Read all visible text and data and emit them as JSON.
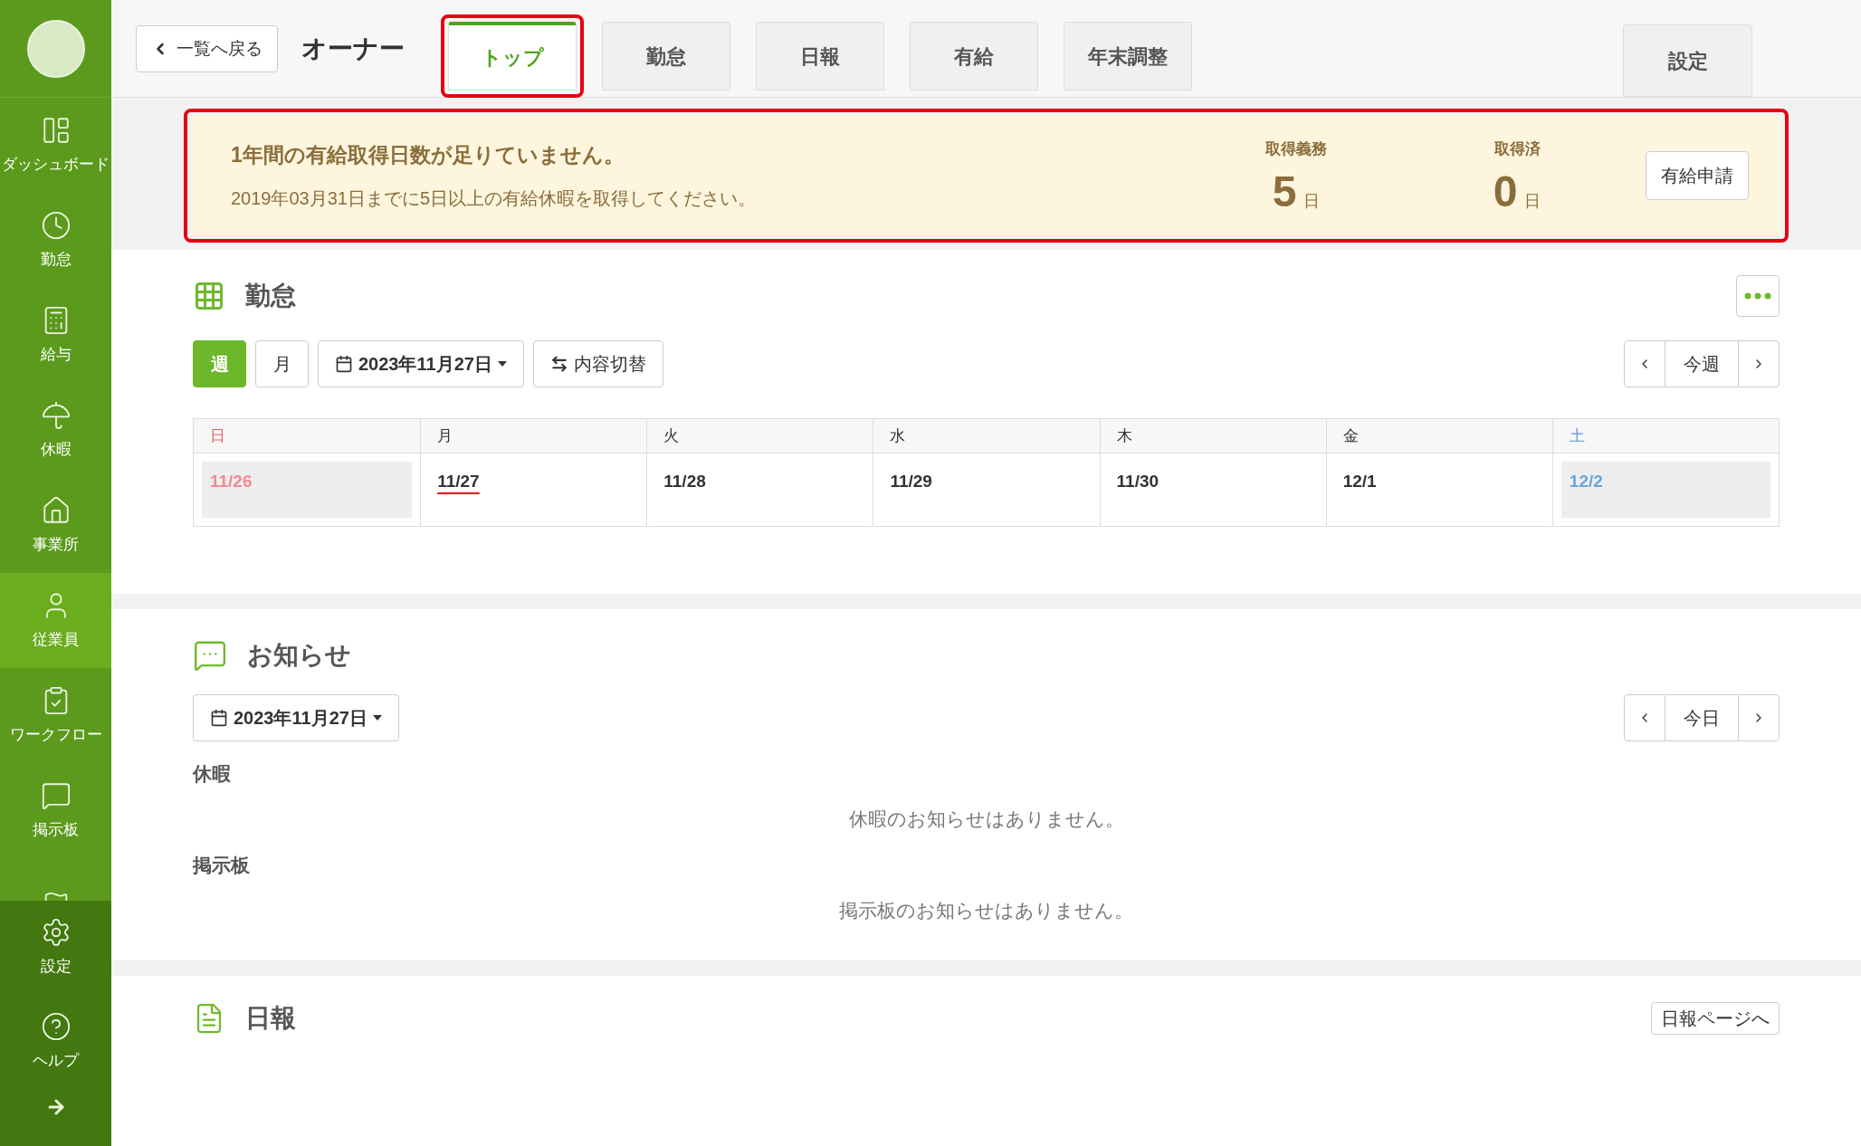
{
  "sidebar": {
    "items": [
      {
        "kind": "dashboard",
        "label": "ダッシュボード",
        "selected": false
      },
      {
        "kind": "clock",
        "label": "勤怠",
        "selected": false
      },
      {
        "kind": "calculator",
        "label": "給与",
        "selected": false
      },
      {
        "kind": "umbrella",
        "label": "休暇",
        "selected": false
      },
      {
        "kind": "house",
        "label": "事業所",
        "selected": false
      },
      {
        "kind": "person",
        "label": "従業員",
        "selected": true
      },
      {
        "kind": "clipboard",
        "label": "ワークフロー",
        "selected": false
      },
      {
        "kind": "chat",
        "label": "掲示板",
        "selected": false
      },
      {
        "kind": "flag"
      }
    ],
    "bottom_items": [
      {
        "kind": "settings",
        "label": "設定"
      },
      {
        "kind": "help",
        "label": "ヘルプ"
      }
    ]
  },
  "header": {
    "back_button": "一覧へ戻る",
    "title": "オーナー",
    "tabs": [
      {
        "label": "トップ",
        "selected": true,
        "highlighted": true
      },
      {
        "label": "勤怠",
        "selected": false,
        "highlighted": false
      },
      {
        "label": "日報",
        "selected": false,
        "highlighted": false
      },
      {
        "label": "有給",
        "selected": false,
        "highlighted": false
      },
      {
        "label": "年末調整",
        "selected": false,
        "highlighted": false
      }
    ],
    "settings_tab": "設定"
  },
  "alert": {
    "highlighted": true,
    "title": "1年間の有給取得日数が足りていません。",
    "message": "2019年03月31日までに5日以上の有給休暇を取得してください。",
    "stats": [
      {
        "label": "取得義務",
        "value": "5",
        "unit": "日"
      },
      {
        "label": "取得済",
        "value": "0",
        "unit": "日"
      }
    ],
    "button": "有給申請"
  },
  "attendance": {
    "title": "勤怠",
    "view_buttons": [
      {
        "label": "週",
        "selected": true
      },
      {
        "label": "月",
        "selected": false
      }
    ],
    "date_picker": "2023年11月27日",
    "toggle_button": "内容切替",
    "nav": {
      "current": "今週"
    },
    "days": [
      {
        "label": "日",
        "kind": "sunday"
      },
      {
        "label": "月",
        "kind": "weekday"
      },
      {
        "label": "火",
        "kind": "weekday"
      },
      {
        "label": "水",
        "kind": "weekday"
      },
      {
        "label": "木",
        "kind": "weekday"
      },
      {
        "label": "金",
        "kind": "weekday"
      },
      {
        "label": "土",
        "kind": "saturday"
      }
    ],
    "dates": [
      {
        "label": "11/26",
        "kind": "sunday",
        "today": false
      },
      {
        "label": "11/27",
        "kind": "weekday",
        "today": true
      },
      {
        "label": "11/28",
        "kind": "weekday",
        "today": false
      },
      {
        "label": "11/29",
        "kind": "weekday",
        "today": false
      },
      {
        "label": "11/30",
        "kind": "weekday",
        "today": false
      },
      {
        "label": "12/1",
        "kind": "weekday",
        "today": false
      },
      {
        "label": "12/2",
        "kind": "saturday",
        "today": false
      }
    ]
  },
  "notices": {
    "title": "お知らせ",
    "date_picker": "2023年11月27日",
    "nav": {
      "current": "今日"
    },
    "groups": [
      {
        "heading": "休暇",
        "empty_message": "休暇のお知らせはありません。"
      },
      {
        "heading": "掲示板",
        "empty_message": "掲示板のお知らせはありません。"
      }
    ]
  },
  "daily_report": {
    "title": "日報",
    "link": "日報ページへ"
  }
}
